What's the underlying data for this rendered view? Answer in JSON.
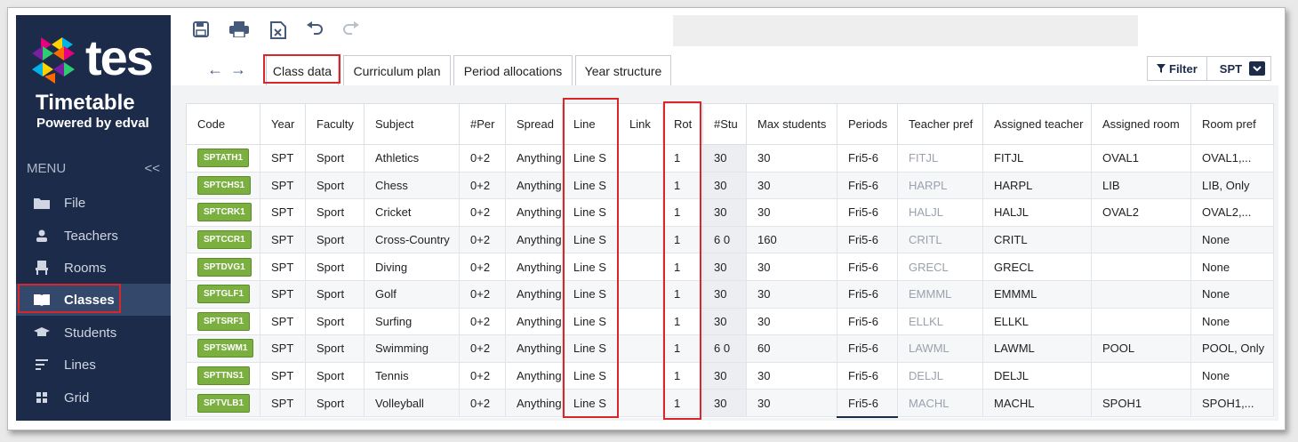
{
  "app": {
    "logo_text": "tes",
    "title": "Timetable",
    "powered_by": "Powered by edval"
  },
  "colors": {
    "sidebar": "#1c2b4a",
    "active_item": "#34486b",
    "highlight": "#d9262b",
    "badge_green": "#7bb041"
  },
  "sidebar": {
    "menu_label": "MENU",
    "collapse_icon": "<<",
    "items": [
      {
        "label": "File",
        "icon": "folder-icon",
        "active": false
      },
      {
        "label": "Teachers",
        "icon": "person-icon",
        "active": false
      },
      {
        "label": "Rooms",
        "icon": "chair-icon",
        "active": false
      },
      {
        "label": "Classes",
        "icon": "book-icon",
        "active": true
      },
      {
        "label": "Students",
        "icon": "graduation-cap-icon",
        "active": false
      },
      {
        "label": "Lines",
        "icon": "lines-icon",
        "active": false
      },
      {
        "label": "Grid",
        "icon": "grid-icon",
        "active": false
      }
    ]
  },
  "toolbar": {
    "icons": [
      "save-icon",
      "print-icon",
      "export-excel-icon",
      "undo-icon",
      "redo-icon"
    ]
  },
  "tabs": [
    {
      "label": "Class data",
      "active": true
    },
    {
      "label": "Curriculum plan",
      "active": false
    },
    {
      "label": "Period allocations",
      "active": false
    },
    {
      "label": "Year structure",
      "active": false
    }
  ],
  "filter": {
    "label": "Filter",
    "value": "SPT"
  },
  "table": {
    "columns": [
      "Code",
      "Year",
      "Faculty",
      "Subject",
      "#Per",
      "Spread",
      "Line",
      "Link",
      "Rot",
      "#Stu",
      "Max students",
      "Periods",
      "Teacher pref",
      "Assigned teacher",
      "Assigned room",
      "Room pref"
    ],
    "rows": [
      [
        "SPTATH1",
        "SPT",
        "Sport",
        "Athletics",
        "0+2",
        "Anything",
        "Line S",
        "",
        "1",
        "30",
        "30",
        "Fri5-6",
        "FITJL",
        "FITJL",
        "OVAL1",
        "OVAL1,..."
      ],
      [
        "SPTCHS1",
        "SPT",
        "Sport",
        "Chess",
        "0+2",
        "Anything",
        "Line S",
        "",
        "1",
        "30",
        "30",
        "Fri5-6",
        "HARPL",
        "HARPL",
        "LIB",
        "LIB, Only"
      ],
      [
        "SPTCRK1",
        "SPT",
        "Sport",
        "Cricket",
        "0+2",
        "Anything",
        "Line S",
        "",
        "1",
        "30",
        "30",
        "Fri5-6",
        "HALJL",
        "HALJL",
        "OVAL2",
        "OVAL2,..."
      ],
      [
        "SPTCCR1",
        "SPT",
        "Sport",
        "Cross-Country",
        "0+2",
        "Anything",
        "Line S",
        "",
        "1",
        "6 0",
        "160",
        "Fri5-6",
        "CRITL",
        "CRITL",
        "",
        "None"
      ],
      [
        "SPTDVG1",
        "SPT",
        "Sport",
        "Diving",
        "0+2",
        "Anything",
        "Line S",
        "",
        "1",
        "30",
        "30",
        "Fri5-6",
        "GRECL",
        "GRECL",
        "",
        "None"
      ],
      [
        "SPTGLF1",
        "SPT",
        "Sport",
        "Golf",
        "0+2",
        "Anything",
        "Line S",
        "",
        "1",
        "30",
        "30",
        "Fri5-6",
        "EMMML",
        "EMMML",
        "",
        "None"
      ],
      [
        "SPTSRF1",
        "SPT",
        "Sport",
        "Surfing",
        "0+2",
        "Anything",
        "Line S",
        "",
        "1",
        "30",
        "30",
        "Fri5-6",
        "ELLKL",
        "ELLKL",
        "",
        "None"
      ],
      [
        "SPTSWM1",
        "SPT",
        "Sport",
        "Swimming",
        "0+2",
        "Anything",
        "Line S",
        "",
        "1",
        "6 0",
        "60",
        "Fri5-6",
        "LAWML",
        "LAWML",
        "POOL",
        "POOL, Only"
      ],
      [
        "SPTTNS1",
        "SPT",
        "Sport",
        "Tennis",
        "0+2",
        "Anything",
        "Line S",
        "",
        "1",
        "30",
        "30",
        "Fri5-6",
        "DELJL",
        "DELJL",
        "",
        "None"
      ],
      [
        "SPTVLB1",
        "SPT",
        "Sport",
        "Volleyball",
        "0+2",
        "Anything",
        "Line S",
        "",
        "1",
        "30",
        "30",
        "Fri5-6",
        "MACHL",
        "MACHL",
        "SPOH1",
        "SPOH1,..."
      ]
    ]
  }
}
